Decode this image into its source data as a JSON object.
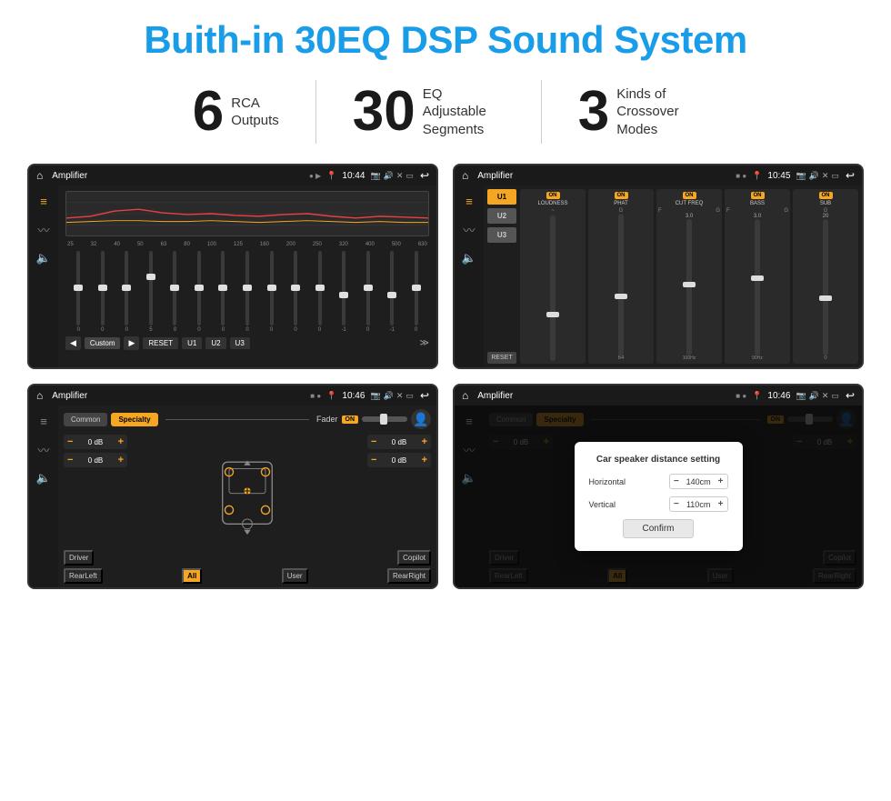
{
  "title": "Buith-in 30EQ DSP Sound System",
  "stats": [
    {
      "number": "6",
      "label": "RCA\nOutputs"
    },
    {
      "number": "30",
      "label": "EQ Adjustable\nSegments"
    },
    {
      "number": "3",
      "label": "Kinds of\nCrossover Modes"
    }
  ],
  "screen1": {
    "statusBar": {
      "title": "Amplifier",
      "time": "10:44"
    },
    "eqFrequencies": [
      "25",
      "32",
      "40",
      "50",
      "63",
      "80",
      "100",
      "125",
      "160",
      "200",
      "250",
      "320",
      "400",
      "500",
      "630"
    ],
    "eqValues": [
      "0",
      "0",
      "0",
      "5",
      "0",
      "0",
      "0",
      "0",
      "0",
      "0",
      "0",
      "-1",
      "0",
      "-1"
    ],
    "presets": [
      "Custom",
      "RESET",
      "U1",
      "U2",
      "U3"
    ]
  },
  "screen2": {
    "statusBar": {
      "title": "Amplifier",
      "time": "10:45"
    },
    "presets": [
      "U1",
      "U2",
      "U3"
    ],
    "controls": [
      "LOUDNESS",
      "PHAT",
      "CUT FREQ",
      "BASS",
      "SUB"
    ],
    "resetLabel": "RESET"
  },
  "screen3": {
    "statusBar": {
      "title": "Amplifier",
      "time": "10:46"
    },
    "tabs": [
      "Common",
      "Specialty"
    ],
    "faderLabel": "Fader",
    "onLabel": "ON",
    "dbValues": [
      "0 dB",
      "0 dB",
      "0 dB",
      "0 dB"
    ],
    "bottomLabels": [
      "Driver",
      "",
      "",
      "Copilot",
      "RearLeft",
      "All",
      "",
      "User",
      "RearRight"
    ]
  },
  "screen4": {
    "statusBar": {
      "title": "Amplifier",
      "time": "10:46"
    },
    "tabs": [
      "Common",
      "Specialty"
    ],
    "dialog": {
      "title": "Car speaker distance setting",
      "horizontal": {
        "label": "Horizontal",
        "value": "140cm"
      },
      "vertical": {
        "label": "Vertical",
        "value": "110cm"
      },
      "confirmLabel": "Confirm"
    },
    "dbValues": [
      "0 dB",
      "0 dB"
    ],
    "bottomLabels": [
      "Driver",
      "Copilot",
      "RearLeft",
      "User",
      "RearRight"
    ]
  }
}
